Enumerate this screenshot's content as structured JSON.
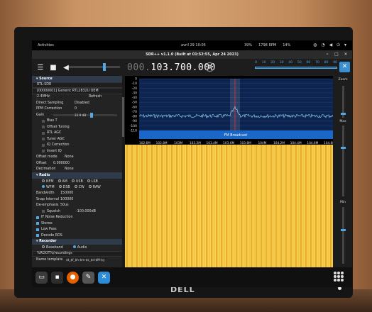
{
  "topbar": {
    "activities": "Activities",
    "clock": "avril 29  10:05",
    "indicators": [
      "39%",
      "1798 RPM",
      "14%"
    ]
  },
  "window": {
    "title": "SDR++ v1.1.0 (Built at 01:52:55, Apr 24 2023)"
  },
  "toolbar": {
    "freq_dim": "000.",
    "freq_main": "103.700.000",
    "scale_nums": [
      "0",
      "10",
      "20",
      "30",
      "40",
      "50",
      "60",
      "70",
      "80",
      "90"
    ]
  },
  "sidebar": {
    "source_header": "Source",
    "source_type": "RTL-SDR",
    "device": "[00000001] Generic RTL2832U OEM",
    "samplerate": "2.4MHz",
    "refresh": "Refresh",
    "direct_sampling_label": "Direct Sampling",
    "direct_sampling_value": "Disabled",
    "ppm_label": "PPM Correction",
    "ppm_value": "0",
    "gain_label": "Gain",
    "gain_value": "22.9 dB",
    "checks": [
      "Bias T",
      "Offset Tuning",
      "RTL AGC",
      "Tuner AGC",
      "IQ Correction",
      "Invert IQ"
    ],
    "offset_mode_label": "Offset mode",
    "offset_mode_value": "None",
    "offset_label": "Offset",
    "offset_value": "0.000000",
    "decimation_label": "Decimation",
    "decimation_value": "None",
    "radio_header": "Radio",
    "modes_row1": [
      "NFM",
      "AM",
      "USB",
      "LSB"
    ],
    "modes_row2": [
      "WFM",
      "DSB",
      "CW",
      "RAW"
    ],
    "bandwidth_label": "Bandwidth",
    "bandwidth_value": "150000",
    "snap_label": "Snap Interval",
    "snap_value": "100000",
    "deemph_label": "De-emphasis",
    "deemph_value": "50us",
    "squelch_label": "Squelch",
    "squelch_value": "-100.000dB",
    "radio_checks": [
      "IF Noise Reduction",
      "Stereo",
      "Low Pass",
      "Decode RDS"
    ],
    "recorder_header": "Recorder",
    "rec_modes": [
      "Baseband",
      "Audio"
    ],
    "rec_path": "%ROOT%/recordings",
    "name_template_label": "Name template",
    "name_template_value": "$t_$f_$h-$m-$s_$d-$M-$y"
  },
  "fft": {
    "db_labels": [
      "0",
      "-10",
      "-20",
      "-30",
      "-40",
      "-50",
      "-60",
      "-70",
      "-80",
      "-90",
      "-100",
      "-110"
    ],
    "freq_labels": [
      "102.6M",
      "102.8M",
      "103M",
      "103.2M",
      "103.4M",
      "103.6M",
      "103.8M",
      "104M",
      "104.2M",
      "104.4M",
      "104.6M",
      "104.8M"
    ],
    "band_label": "FM Broadcast"
  },
  "zoom": {
    "zoom_label": "Zoom",
    "max_label": "Max",
    "min_label": "Min"
  },
  "monitor": {
    "brand": "DELL"
  }
}
